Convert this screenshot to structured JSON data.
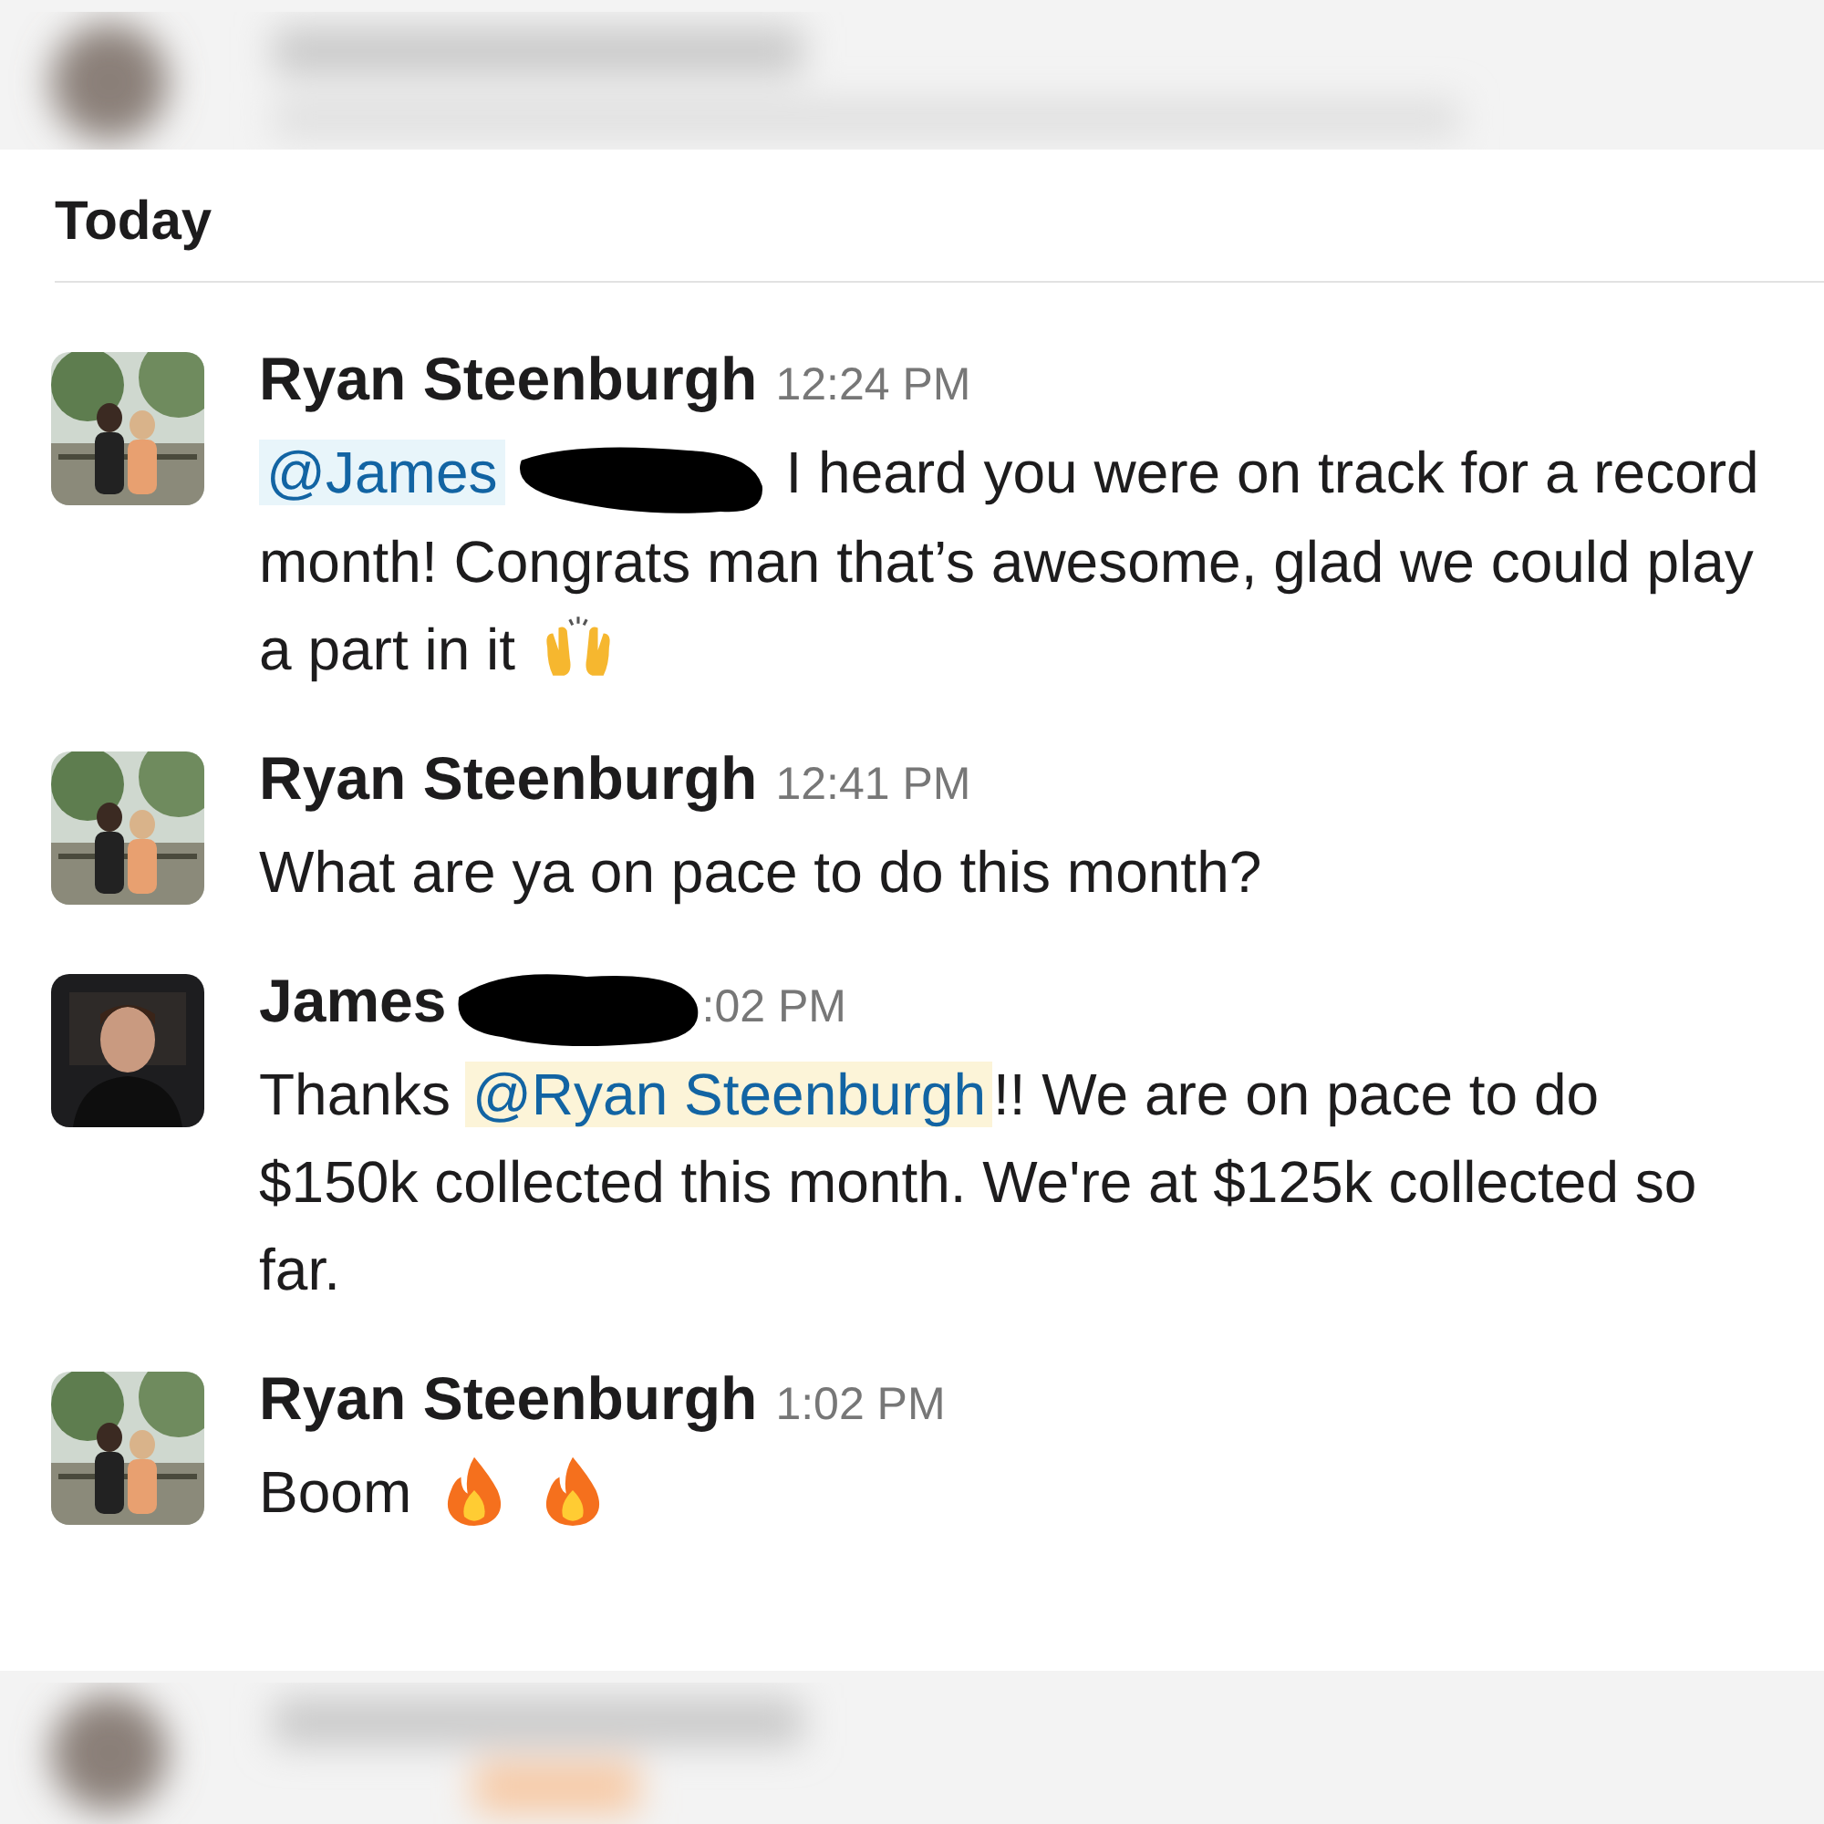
{
  "day_divider": "Today",
  "messages": [
    {
      "author": "Ryan Steenburgh",
      "name_redacted": false,
      "time": "12:24 PM",
      "avatar": {
        "kind": "picture"
      },
      "parts": [
        {
          "kind": "mention",
          "text": "@James"
        },
        {
          "kind": "redaction"
        },
        {
          "kind": "text",
          "text": "I heard you were on track for a record month! Congrats man that’s awesome, glad we could play a part in it"
        },
        {
          "kind": "raised-hands"
        }
      ]
    },
    {
      "author": "Ryan Steenburgh",
      "name_redacted": false,
      "time": "12:41 PM",
      "avatar": {
        "kind": "picture"
      },
      "parts": [
        {
          "kind": "text",
          "text": "What are ya on pace to do this month?"
        }
      ]
    },
    {
      "author": "James",
      "name_redacted": true,
      "time": ":02 PM",
      "avatar": {
        "kind": "picture"
      },
      "parts": [
        {
          "kind": "text",
          "text": "Thanks"
        },
        {
          "kind": "mention_self",
          "text": "@Ryan Steenburgh"
        },
        {
          "kind": "text",
          "text": "!! We are on pace to do $150k collected this month. We're at $125k collected so far."
        }
      ]
    },
    {
      "author": "Ryan Steenburgh",
      "name_redacted": false,
      "time": "1:02 PM",
      "avatar": {
        "kind": "picture"
      },
      "parts": [
        {
          "kind": "text",
          "text": "Boom"
        },
        {
          "kind": "fire"
        },
        {
          "kind": "fire"
        }
      ]
    }
  ]
}
